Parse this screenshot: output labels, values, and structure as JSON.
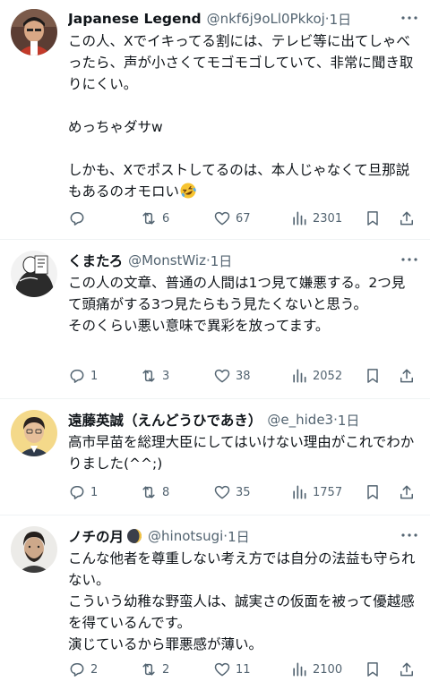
{
  "tweets": [
    {
      "name": "Japanese Legend",
      "handle": "@nkf6j9oLl0Pkkoj",
      "sep": "·",
      "time": "1日",
      "text": "この人、Xでイキってる割には、テレビ等に出てしゃべったら、声が小さくてモゴモゴしていて、非常に聞き取りにくい。\n\nめっちゃダサw\n\nしかも、Xでポストしてるのは、本人じゃなくて旦那説もあるのオモロい",
      "text_emoji": "rolling-on-floor-laughing-emoji",
      "replies": "",
      "reposts": "6",
      "likes": "67",
      "views": "2301"
    },
    {
      "name": "くまたろ",
      "handle": "@MonstWiz",
      "sep": "·",
      "time": "1日",
      "text": "この人の文章、普通の人間は1つ見て嫌悪する。2つ見て頭痛がする3つ見たらもう見たくないと思う。\nそのくらい悪い意味で異彩を放ってます。",
      "replies": "1",
      "reposts": "3",
      "likes": "38",
      "views": "2052"
    },
    {
      "name": "遠藤英誠（えんどうひであき）",
      "handle": "@e_hide3",
      "sep": "·",
      "time": "1日",
      "text": "高市早苗を総理大臣にしてはいけない理由がこれでわかりました(^^;)",
      "replies": "1",
      "reposts": "8",
      "likes": "35",
      "views": "1757"
    },
    {
      "name": "ノチの月",
      "name_emoji": "crescent-moon-emoji",
      "handle": "@hinotsugi",
      "sep": "·",
      "time": "1日",
      "text": "こんな他者を尊重しない考え方では自分の法益も守られない。\nこういう幼稚な野蛮人は、誠実さの仮面を被って優越感を得ているんです。\n演じているから罪悪感が薄い。",
      "replies": "2",
      "reposts": "2",
      "likes": "11",
      "views": "2100"
    }
  ],
  "icons": {
    "reply": "speech-bubble-icon",
    "repost": "repost-arrows-icon",
    "like": "heart-icon",
    "views": "bar-chart-icon",
    "bookmark": "bookmark-icon",
    "share": "share-upload-icon",
    "more": "more-dots-icon"
  },
  "colors": {
    "text": "#0f1419",
    "secondary": "#536471",
    "divider": "#eff3f4"
  }
}
